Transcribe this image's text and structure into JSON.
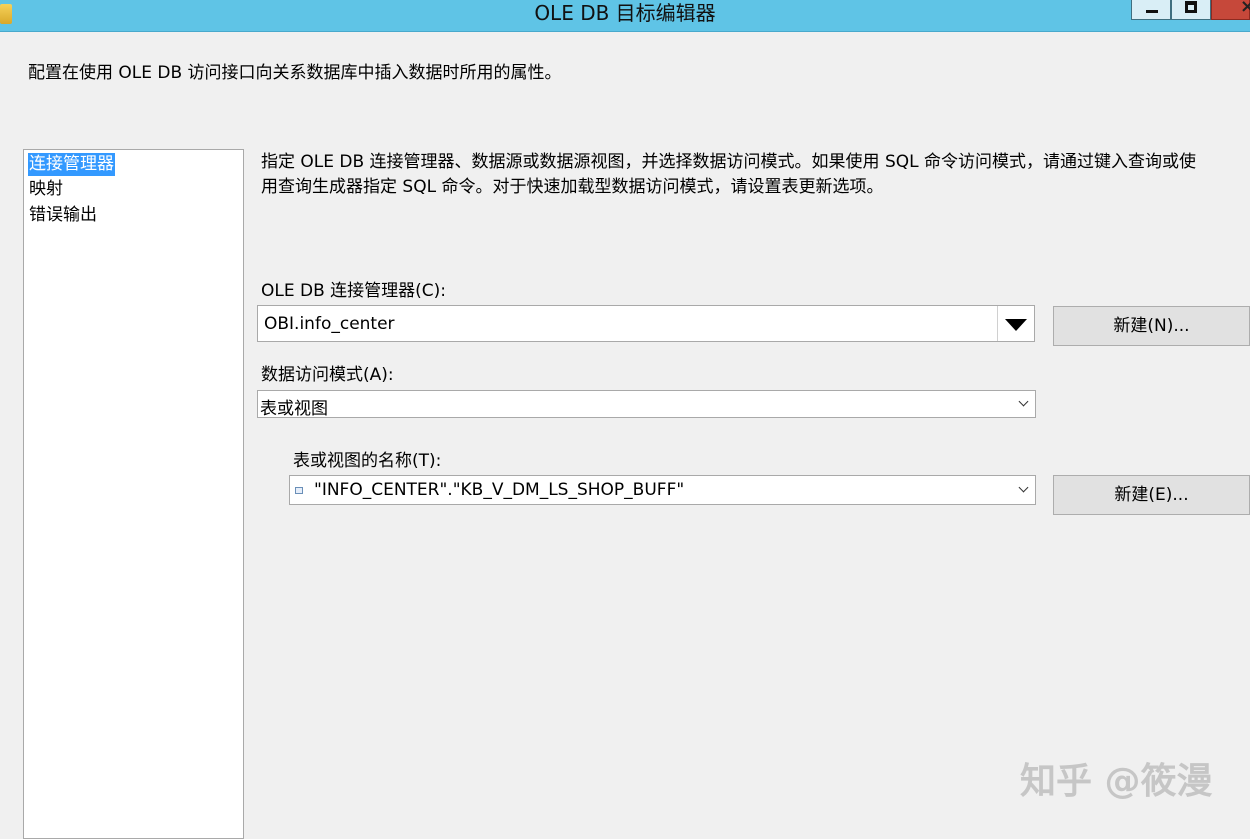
{
  "window": {
    "title": "OLE DB 目标编辑器"
  },
  "description": "配置在使用 OLE DB 访问接口向关系数据库中插入数据时所用的属性。",
  "nav": {
    "items": [
      {
        "label": "连接管理器",
        "selected": true
      },
      {
        "label": "映射",
        "selected": false
      },
      {
        "label": "错误输出",
        "selected": false
      }
    ]
  },
  "instructions": "指定 OLE DB 连接管理器、数据源或数据源视图，并选择数据访问模式。如果使用 SQL 命令访问模式，请通过键入查询或使\n用查询生成器指定 SQL 命令。对于快速加载型数据访问模式，请设置表更新选项。",
  "connection_manager": {
    "label": "OLE DB 连接管理器(C):",
    "value": "OBI.info_center",
    "new_button": "新建(N)..."
  },
  "access_mode": {
    "label": "数据访问模式(A):",
    "value": "表或视图"
  },
  "table_name": {
    "label": "表或视图的名称(T):",
    "value": "\"INFO_CENTER\".\"KB_V_DM_LS_SHOP_BUFF\"",
    "new_button": "新建(E)..."
  },
  "watermark": "知乎 @筱漫"
}
